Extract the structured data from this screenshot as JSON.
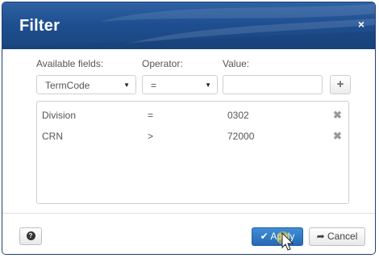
{
  "dialog": {
    "title": "Filter",
    "close_glyph": "×"
  },
  "fields": {
    "available_label": "Available fields:",
    "operator_label": "Operator:",
    "value_label": "Value:",
    "available_selected": "TermCode",
    "operator_selected": "=",
    "value_text": "",
    "add_glyph": "+"
  },
  "filters": [
    {
      "field": "Division",
      "operator": "=",
      "value": "0302",
      "remove_glyph": "✖"
    },
    {
      "field": "CRN",
      "operator": ">",
      "value": "72000",
      "remove_glyph": "✖"
    }
  ],
  "footer": {
    "help_glyph": "?",
    "apply_label": "Apply",
    "apply_icon": "✔",
    "cancel_label": "Cancel",
    "cancel_icon": "➦"
  },
  "icons": {
    "close": "close-icon",
    "add": "plus-icon",
    "remove": "remove-x-icon",
    "help": "question-circle-icon",
    "apply": "checkmark-icon",
    "cancel": "arrow-back-icon",
    "caret": "caret-down-icon"
  },
  "colors": {
    "title_bar": "#1f4f91",
    "apply_button": "#2f78c4"
  }
}
